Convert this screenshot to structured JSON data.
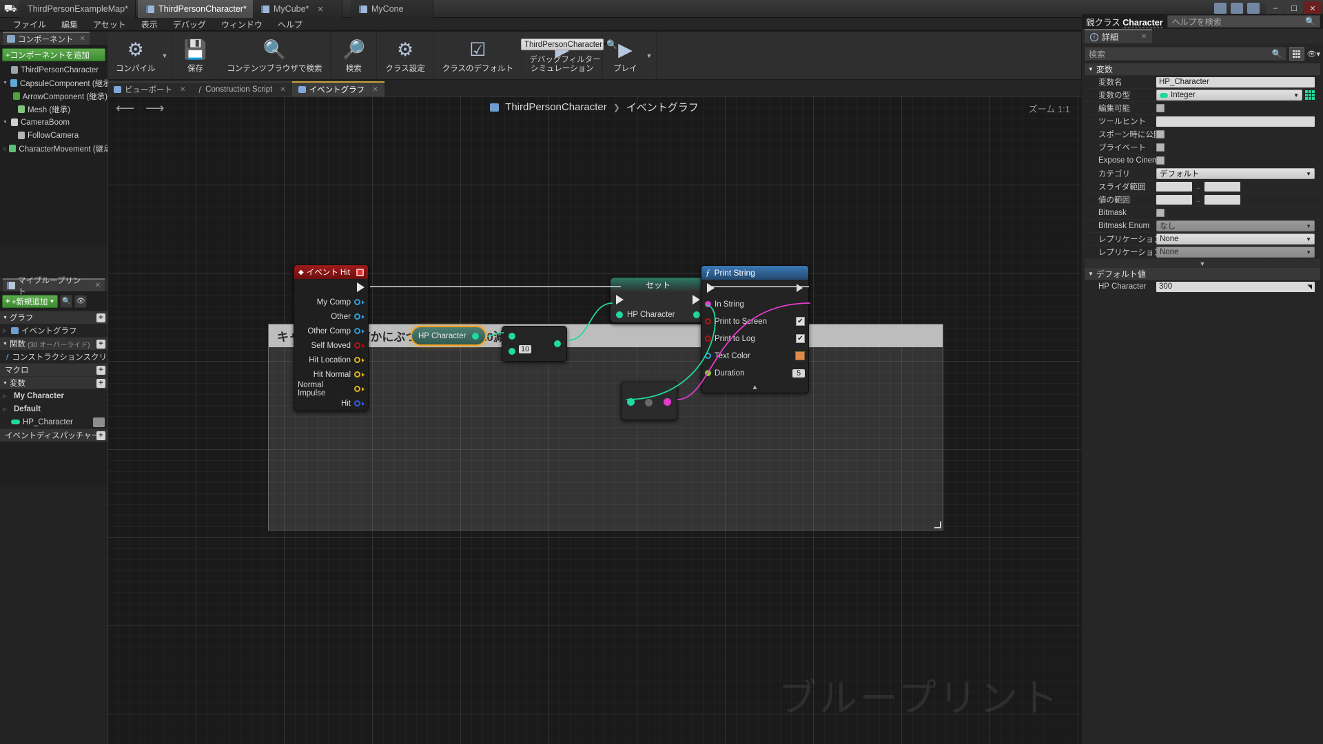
{
  "window": {
    "tabs": [
      {
        "label": "ThirdPersonExampleMap*",
        "active": false,
        "closable": false,
        "icon": "map-icon"
      },
      {
        "label": "ThirdPersonCharacter*",
        "active": true,
        "closable": true,
        "icon": "blueprint-icon"
      },
      {
        "label": "MyCube*",
        "active": false,
        "closable": true,
        "icon": "blueprint-icon"
      },
      {
        "label": "MyCone",
        "active": false,
        "closable": false,
        "icon": "blueprint-icon"
      }
    ],
    "controls": {
      "minimize": "–",
      "maximize": "☐",
      "close": "✕"
    }
  },
  "menubar": [
    "ファイル",
    "編集",
    "アセット",
    "表示",
    "デバッグ",
    "ウィンドウ",
    "ヘルプ"
  ],
  "toolbar": {
    "items": [
      {
        "label": "コンパイル",
        "icon": "compile-icon",
        "has_dropdown": true
      },
      {
        "label": "保存",
        "icon": "save-icon"
      },
      {
        "label": "コンテンツブラウザで検索",
        "icon": "browse-icon"
      },
      {
        "label": "検索",
        "icon": "find-icon"
      },
      {
        "label": "クラス設定",
        "icon": "class-settings-icon"
      },
      {
        "label": "クラスのデフォルト",
        "icon": "class-defaults-icon"
      },
      {
        "label": "シミュレーション",
        "icon": "simulate-icon"
      },
      {
        "label": "プレイ",
        "icon": "play-icon",
        "has_dropdown": true
      }
    ],
    "debug_target": "ThirdPersonCharacter",
    "debug_filter_label": "デバッグフィルター"
  },
  "components_panel": {
    "tab_label": "コンポーネント",
    "add_button": "+コンポーネントを追加",
    "tree": [
      {
        "label": "ThirdPersonCharacter",
        "indent": 0,
        "arrow": "",
        "color": "#9aa5ad",
        "icon": "actor-icon"
      },
      {
        "label": "CapsuleComponent (継承)",
        "indent": 0,
        "arrow": "▼",
        "color": "#5fa8d8",
        "icon": "capsule-icon"
      },
      {
        "label": "ArrowComponent (継承)",
        "indent": 1,
        "arrow": "",
        "color": "#4fa33f",
        "icon": "arrow-icon"
      },
      {
        "label": "Mesh (継承)",
        "indent": 1,
        "arrow": "",
        "color": "#7fc47a",
        "icon": "mesh-icon"
      },
      {
        "label": "CameraBoom",
        "indent": 0,
        "arrow": "▼",
        "color": "#cfcfcf",
        "icon": "spring-arm-icon"
      },
      {
        "label": "FollowCamera",
        "indent": 1,
        "arrow": "",
        "color": "#b4b4b4",
        "icon": "camera-icon"
      },
      {
        "label": "CharacterMovement (継承)",
        "indent": 0,
        "arrow": "◇",
        "color": "#5fbf7a",
        "icon": "movement-icon"
      }
    ]
  },
  "myblueprint_panel": {
    "tab_label": "マイブループリント",
    "add_button": "+新規追加",
    "search_icon": "search-icon",
    "eye_icon": "eye-icon",
    "sections": [
      {
        "label": "グラフ",
        "arrow": "▼",
        "plus": "+",
        "items": [
          {
            "label": "イベントグラフ",
            "arrow": "▷",
            "icon": "graph-icon",
            "color": "#6f9fd0"
          }
        ]
      },
      {
        "label": "関数",
        "note": "(30 オーバーライド)",
        "arrow": "▼",
        "plus": "+",
        "items": [
          {
            "label": "コンストラクションスクリプト",
            "arrow": "",
            "icon": "function-icon",
            "color": "#5b8fd6"
          }
        ]
      },
      {
        "label": "マクロ",
        "arrow": "",
        "plus": "+",
        "items": []
      },
      {
        "label": "変数",
        "arrow": "▼",
        "plus": "+",
        "items": [
          {
            "label": "My Character",
            "arrow": "▷",
            "icon": "folder-icon",
            "color": "#cfcfcf"
          },
          {
            "label": "Default",
            "arrow": "▷",
            "icon": "folder-icon",
            "color": "#cfcfcf"
          },
          {
            "label": "HP_Character",
            "arrow": "",
            "icon": "integer-pill-icon",
            "color": "#1fd9a0",
            "has_eye": true
          }
        ]
      },
      {
        "label": "イベントディスパッチャー",
        "arrow": "",
        "plus": "+",
        "items": []
      }
    ]
  },
  "graph_tabs": [
    {
      "label": "ビューポート",
      "icon": "viewport-icon",
      "active": false,
      "closable": true
    },
    {
      "label": "Construction Script",
      "icon": "function-icon",
      "active": false,
      "closable": true
    },
    {
      "label": "イベントグラフ",
      "icon": "graph-icon",
      "active": true,
      "closable": true
    }
  ],
  "graph": {
    "breadcrumb": {
      "root": "ThirdPersonCharacter",
      "sep": "❯",
      "current": "イベントグラフ",
      "icon": "graph-icon"
    },
    "zoom_label": "ズーム 1:1",
    "back_icon": "back-arrow-icon",
    "forward_icon": "forward-arrow-icon",
    "watermark": "ブループリント",
    "comment": {
      "text": "キャラクターが何かにぶつかるとHPが10減る。"
    },
    "nodes": [
      {
        "id": "event-hit",
        "title": "イベント Hit",
        "title_icon": "event-diamond-icon",
        "header_color": "#8a1414",
        "has_delegate_box": true,
        "exec_out": true,
        "pins": [
          {
            "label": "My Comp",
            "color": "#2e9fe0",
            "side": "out"
          },
          {
            "label": "Other",
            "color": "#2e9fe0",
            "side": "out"
          },
          {
            "label": "Other Comp",
            "color": "#2e9fe0",
            "side": "out"
          },
          {
            "label": "Self Moved",
            "color": "#b31414",
            "side": "out"
          },
          {
            "label": "Hit Location",
            "color": "#e0b320",
            "side": "out"
          },
          {
            "label": "Hit Normal",
            "color": "#e0b320",
            "side": "out"
          },
          {
            "label": "Normal Impulse",
            "color": "#e0b320",
            "side": "out"
          },
          {
            "label": "Hit",
            "color": "#2e5fe0",
            "side": "out"
          }
        ]
      },
      {
        "id": "get-hp-character",
        "title": "HP Character",
        "style": "variable-get",
        "selected": true,
        "pin_color": "#1fd9a0"
      },
      {
        "id": "subtract-node",
        "title": "",
        "style": "compact-math",
        "literal_value": "10",
        "pin_color": "#1fd9a0"
      },
      {
        "id": "set-node",
        "title": "セット",
        "style": "set-variable",
        "header_color": "#1f6e58",
        "pins": [
          {
            "label": "HP Character",
            "color": "#1fd9a0"
          }
        ]
      },
      {
        "id": "convert-node",
        "title": "",
        "style": "compact-convert",
        "in_color": "#1fd9a0",
        "out_color": "#e83ad0"
      },
      {
        "id": "print-string",
        "title": "Print String",
        "title_icon": "function-f-icon",
        "header_color": "#2b5f99",
        "exec_in": true,
        "exec_out": true,
        "pins": [
          {
            "label": "In String",
            "color": "#e83ad0",
            "side": "in"
          },
          {
            "label": "Print to Screen",
            "color": "#b31414",
            "side": "in",
            "checkbox": true,
            "checked": true
          },
          {
            "label": "Print to Log",
            "color": "#b31414",
            "side": "in",
            "checkbox": true,
            "checked": true
          },
          {
            "label": "Text Color",
            "color": "#2e9fe0",
            "side": "in",
            "swatch": "#e08a4a"
          },
          {
            "label": "Duration",
            "color": "#8ecf2a",
            "side": "in",
            "value": "5"
          }
        ],
        "collapse_icon": "chevron-up-icon"
      }
    ]
  },
  "details_panel": {
    "parent_class_label": "親クラス",
    "parent_class_value": "Character",
    "help_search_placeholder": "ヘルプを検索",
    "help_search_icon": "search-icon",
    "tab_label": "詳細",
    "tab_icon": "details-icon",
    "search_placeholder": "検索",
    "search_icon": "search-icon",
    "grid_icon": "grid-view-icon",
    "eye_icon": "eye-icon",
    "sections": [
      {
        "label": "変数",
        "arrow": "▼",
        "rows": [
          {
            "label": "変数名",
            "type": "text",
            "value": "HP_Character"
          },
          {
            "label": "変数の型",
            "type": "dropdown-type",
            "value": "Integer",
            "swatch": "#1fd9a0",
            "grid": true
          },
          {
            "label": "編集可能",
            "type": "checkbox",
            "value": false
          },
          {
            "label": "ツールヒント",
            "type": "text",
            "value": ""
          },
          {
            "label": "スポーン時に公開",
            "type": "checkbox",
            "value": false
          },
          {
            "label": "プライベート",
            "type": "checkbox",
            "value": false
          },
          {
            "label": "Expose to Cinematics",
            "type": "checkbox",
            "value": false
          },
          {
            "label": "カテゴリ",
            "type": "dropdown",
            "value": "デフォルト"
          },
          {
            "label": "スライダ範囲",
            "type": "range",
            "value": [
              "",
              ""
            ]
          },
          {
            "label": "値の範囲",
            "type": "range",
            "value": [
              "",
              ""
            ]
          },
          {
            "label": "Bitmask",
            "type": "checkbox",
            "value": false
          },
          {
            "label": "Bitmask Enum",
            "type": "dropdown-dim",
            "value": "なし"
          },
          {
            "label": "レプリケーション",
            "type": "dropdown",
            "value": "None"
          },
          {
            "label": "レプリケーション条件",
            "type": "dropdown-dim",
            "value": "None"
          }
        ]
      },
      {
        "label": "デフォルト値",
        "arrow": "▼",
        "rows": [
          {
            "label": "HP Character",
            "type": "text-spin",
            "value": "300"
          }
        ]
      }
    ],
    "collapse_icon": "chevron-down-icon"
  }
}
